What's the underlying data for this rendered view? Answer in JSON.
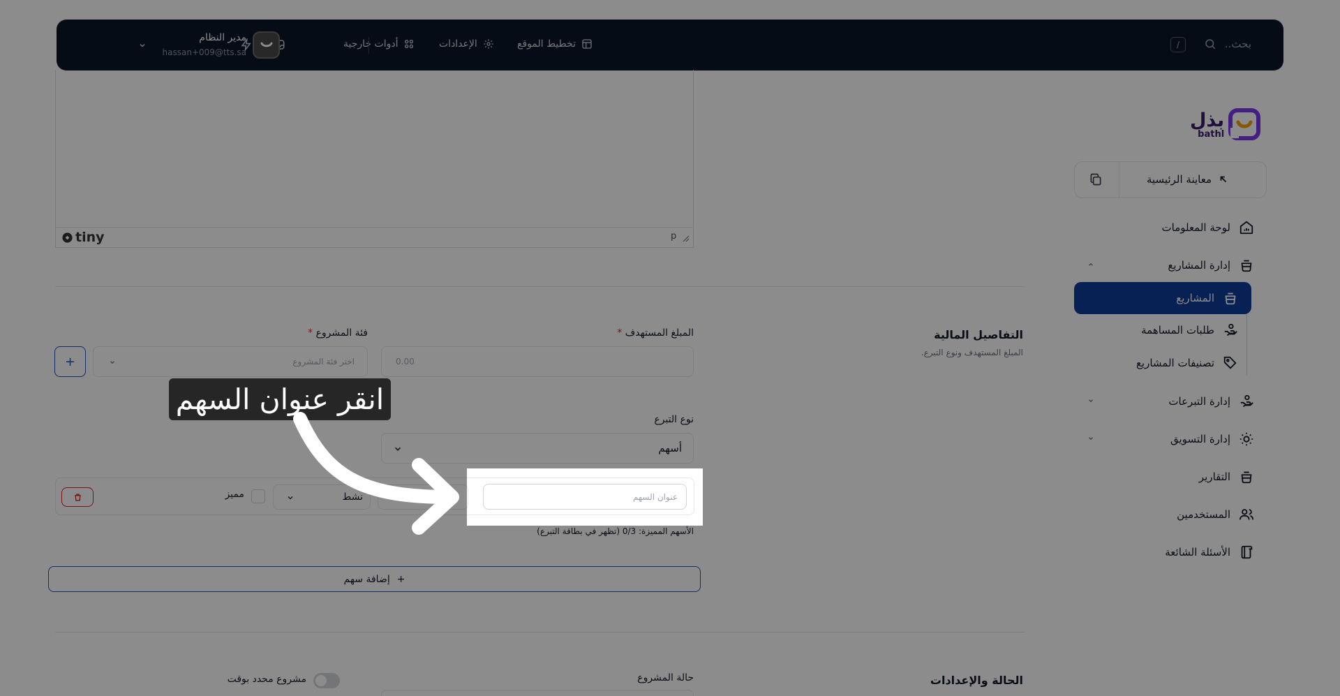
{
  "topbar": {
    "search_placeholder": "بحث..",
    "shortcut_key": "/",
    "site_layout": "تخطيط الموقع",
    "settings": "الإعدادات",
    "external_tools": "أدوات خارجية",
    "user_name": "مدير النظام",
    "user_email": "hassan+009@tts.sa"
  },
  "editor": {
    "brand": "tiny",
    "path": "p"
  },
  "sidebar": {
    "logo_ar": "بذل",
    "logo_en": "bathl",
    "preview_home": "معاينة الرئيسية",
    "items": {
      "dashboard": "لوحة المعلومات",
      "projects_mgmt": "إدارة المشاريع",
      "projects": "المشاريع",
      "contribution_requests": "طلبات المساهمة",
      "project_categories": "تصنيفات المشاريع",
      "donations_mgmt": "إدارة التبرعات",
      "marketing_mgmt": "إدارة التسويق",
      "reports": "التقارير",
      "users": "المستخدمين",
      "faq": "الأسئلة الشائعة"
    }
  },
  "financial": {
    "title": "التفاصيل المالية",
    "subtitle": "المبلغ المستهدف ونوع التبرع.",
    "target_amount_label": "المبلغ المستهدف",
    "target_amount_placeholder": "0.00",
    "category_label": "فئة المشروع",
    "category_placeholder": "اختر فئة المشروع",
    "donation_type_label": "نوع التبرع",
    "donation_type_value": "أسهم",
    "share_title_placeholder": "عنوان السهم",
    "status_value": "نشط",
    "featured_label": "مميز",
    "featured_note": "الأسهم المميزة: 0/3 (تظهر في بطاقة التبرع)",
    "add_share": "إضافة سهم"
  },
  "status_section": {
    "title": "الحالة والإعدادات",
    "project_status_label": "حالة المشروع",
    "timed_project_label": "مشروع محدد بوقت"
  },
  "tooltip": {
    "text": "انقر عنوان السهم"
  }
}
